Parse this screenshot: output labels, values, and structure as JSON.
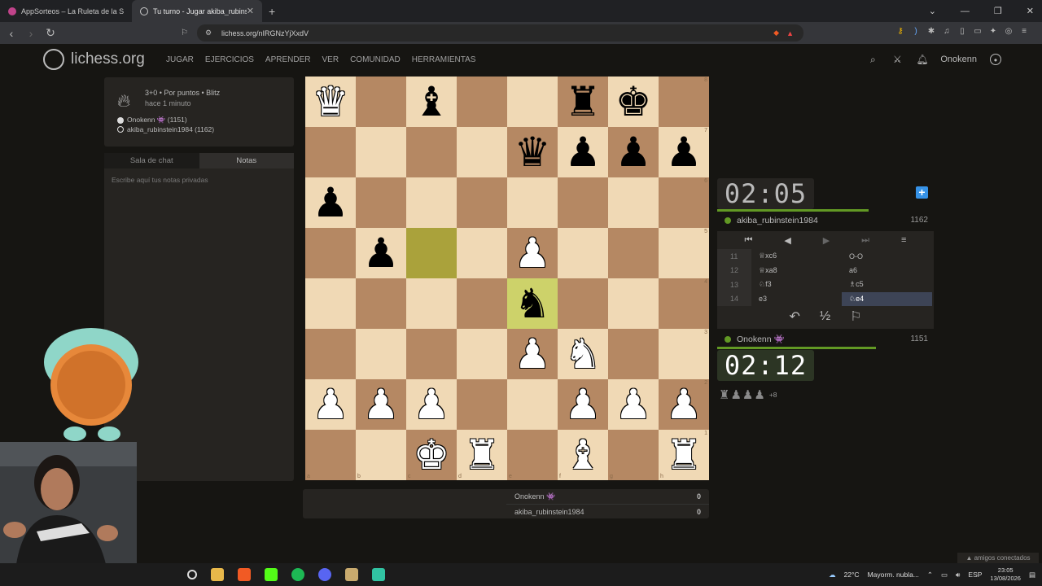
{
  "browser": {
    "tabs": [
      {
        "title": "AppSorteos – La Ruleta de la Suerte",
        "active": false
      },
      {
        "title": "Tu turno - Jugar akiba_rubinst…",
        "active": true
      }
    ],
    "url": "lichess.org/nIRGNzYjXxdV"
  },
  "header": {
    "logo": "lichess.org",
    "nav": [
      "JUGAR",
      "EJERCICIOS",
      "APRENDER",
      "VER",
      "COMUNIDAD",
      "HERRAMIENTAS"
    ],
    "username": "Onokenn"
  },
  "game": {
    "mode": "3+0 • Por puntos • Blitz",
    "time_ago": "hace 1 minuto",
    "white_player": "Onokenn 👾 (1151)",
    "black_player": "akiba_rubinstein1984 (1162)"
  },
  "chat": {
    "tabs": [
      "Sala de chat",
      "Notas"
    ],
    "active_tab": "Notas",
    "placeholder": "Escribe aquí tus notas privadas"
  },
  "board": {
    "files": [
      "a",
      "b",
      "c",
      "d",
      "e",
      "f",
      "g",
      "h"
    ],
    "ranks": [
      "8",
      "7",
      "6",
      "5",
      "4",
      "3",
      "2",
      "1"
    ],
    "position": [
      [
        "wQ",
        "",
        "bB",
        "",
        "",
        "bR",
        "bK",
        ""
      ],
      [
        "",
        "",
        "",
        "",
        "bQ",
        "bP",
        "bP",
        "bP"
      ],
      [
        "bP",
        "",
        "",
        "",
        "",
        "",
        "",
        ""
      ],
      [
        "",
        "bP",
        "",
        "",
        "wP",
        "",
        "",
        ""
      ],
      [
        "",
        "",
        "",
        "",
        "bN",
        "",
        "",
        ""
      ],
      [
        "",
        "",
        "",
        "",
        "wP",
        "wN",
        "",
        ""
      ],
      [
        "wP",
        "wP",
        "wP",
        "",
        "",
        "wP",
        "wP",
        "wP"
      ],
      [
        "",
        "",
        "wK",
        "wR",
        "",
        "wB",
        "",
        "wR"
      ]
    ],
    "highlight_from": "c5",
    "highlight_to": "e4"
  },
  "opponent": {
    "clock": "02:05",
    "name": "akiba_rubinstein1984",
    "rating": "1162"
  },
  "player": {
    "clock": "02:12",
    "name": "Onokenn 👾",
    "rating": "1151",
    "material_diff": "+8"
  },
  "moves": [
    {
      "n": "11",
      "w": "♕xc6",
      "b": "O-O"
    },
    {
      "n": "12",
      "w": "♕xa8",
      "b": "a6"
    },
    {
      "n": "13",
      "w": "♘f3",
      "b": "♗c5"
    },
    {
      "n": "14",
      "w": "e3",
      "b": "♘e4"
    }
  ],
  "score": [
    {
      "name": "Onokenn 👾",
      "points": "0"
    },
    {
      "name": "akiba_rubinstein1984",
      "points": "0"
    }
  ],
  "system": {
    "weather": "22°C",
    "weather_text": "Mayorm. nubla...",
    "lang": "ESP",
    "time": "23:05",
    "date": "13/08/2026",
    "friends": "amigos conectados"
  }
}
